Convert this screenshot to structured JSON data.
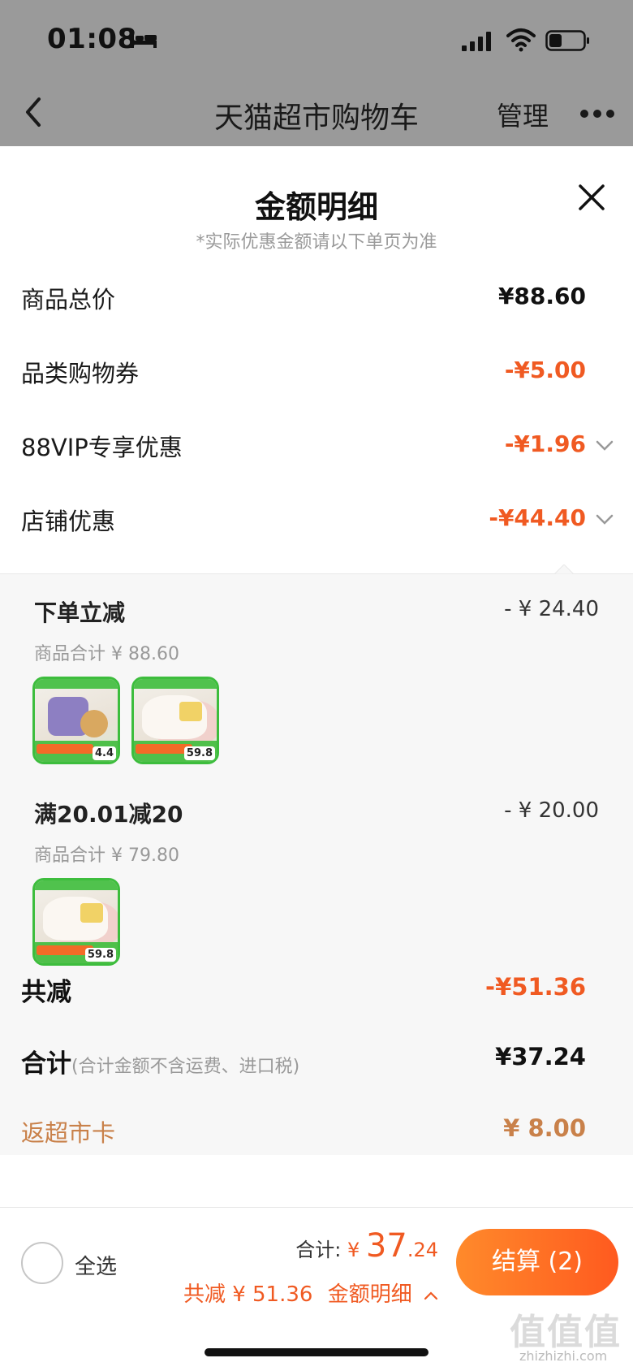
{
  "status_bar": {
    "time": "01:08"
  },
  "nav": {
    "title": "天猫超市购物车",
    "manage": "管理"
  },
  "sheet": {
    "title": "金额明细",
    "note": "*实际优惠金额请以下单页为准",
    "rows": [
      {
        "label": "商品总价",
        "value": "¥88.60"
      },
      {
        "label": "品类购物券",
        "value": "-¥5.00"
      },
      {
        "label": "88VIP专享优惠",
        "value": "-¥1.96"
      },
      {
        "label": "店铺优惠",
        "value": "-¥44.40"
      }
    ],
    "promos": [
      {
        "title": "下单立减",
        "amount": "- ¥ 24.40",
        "subtotal": "商品合计 ¥ 88.60",
        "thumb_prices": [
          "4.4",
          "59.8"
        ]
      },
      {
        "title": "满20.01减20",
        "amount": "- ¥ 20.00",
        "subtotal": "商品合计 ¥ 79.80",
        "thumb_prices": [
          "59.8"
        ]
      }
    ],
    "total_discount": {
      "label": "共减",
      "value": "-¥51.36"
    },
    "total": {
      "label": "合计",
      "note": "(合计金额不含运费、进口税)",
      "value": "¥37.24"
    },
    "card_back": {
      "label": "返超市卡",
      "value": "¥ 8.00"
    }
  },
  "bottom": {
    "select_all": "全选",
    "total_prefix": "合计:",
    "currency": "¥",
    "total_int": "37",
    "total_dec": ".24",
    "discount_text": "共减 ¥ 51.36",
    "detail_link": "金额明细",
    "checkout": "结算 (2)"
  },
  "watermark": {
    "main": "值值值",
    "sub": "zhizhizhi.com"
  },
  "colors": {
    "accent": "#f05a22",
    "card": "#c9814a",
    "thumb_border": "#3dbd3d"
  }
}
